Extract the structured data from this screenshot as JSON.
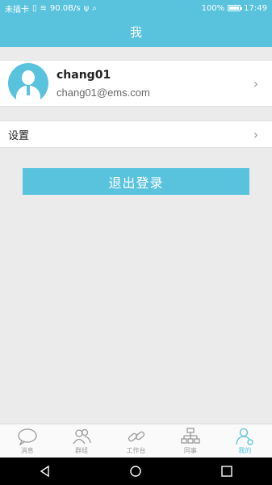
{
  "status_bar": {
    "carrier": "未插卡",
    "speed": "90.0B/s",
    "battery": "100%",
    "battery_level": 1.0,
    "time": "17:49"
  },
  "header": {
    "title": "我"
  },
  "profile": {
    "name": "chang01",
    "email": "chang01@ems.com",
    "avatar_icon": "user-avatar-icon"
  },
  "menu": {
    "settings_label": "设置"
  },
  "logout_label": "退出登录",
  "tabs": [
    {
      "label": "消息",
      "icon": "chat-bubble-icon"
    },
    {
      "label": "群组",
      "icon": "group-icon"
    },
    {
      "label": "工作台",
      "icon": "link-icon"
    },
    {
      "label": "同事",
      "icon": "org-chart-icon"
    },
    {
      "label": "我的",
      "icon": "profile-icon",
      "active": true
    }
  ],
  "colors": {
    "accent": "#59c2dd",
    "background": "#ebebeb",
    "tab_inactive": "#9a9a9a"
  }
}
